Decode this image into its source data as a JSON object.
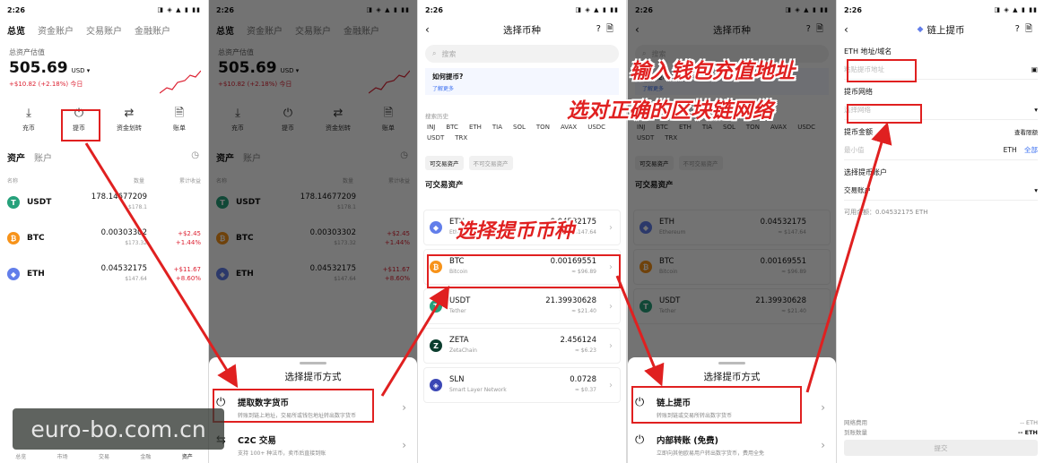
{
  "status": {
    "time": "2:26",
    "icons": "◨ ◈ ▲ ▮ ▮▮"
  },
  "screen1": {
    "tabs": [
      "总览",
      "资金账户",
      "交易账户",
      "金融账户"
    ],
    "balance_label": "总资产估值",
    "balance": "505.69",
    "balance_unit": "USD ▾",
    "pnl": "+$10.82 (+2.18%) 今日",
    "actions": [
      {
        "icon": "download-icon",
        "glyph": "⤓",
        "label": "充币"
      },
      {
        "icon": "withdraw-icon",
        "glyph": "⏻",
        "label": "提币"
      },
      {
        "icon": "transfer-icon",
        "glyph": "⇄",
        "label": "资金划转"
      },
      {
        "icon": "bill-icon",
        "glyph": "🗎",
        "label": "账单"
      }
    ],
    "subtabs": [
      "资产",
      "账户"
    ],
    "col_headers": [
      "名称",
      "数量",
      "累计收益"
    ],
    "assets": [
      {
        "symbol": "USDT",
        "amount": "178.14677209",
        "usd": "$178.1",
        "pnl": "",
        "pnl2": ""
      },
      {
        "symbol": "BTC",
        "amount": "0.00303302",
        "usd": "$173.32",
        "pnl": "+$2.45",
        "pnl2": "+1.44%"
      },
      {
        "symbol": "ETH",
        "amount": "0.04532175",
        "usd": "$147.64",
        "pnl": "+$11.67",
        "pnl2": "+8.60%"
      }
    ],
    "nav": [
      "总览",
      "市场",
      "交易",
      "金融",
      "资产"
    ]
  },
  "screen2": {
    "sheet_title": "选择提币方式",
    "option1_title": "提取数字货币",
    "option1_sub": "转账到链上地址，交易所或钱包地址转出数字货币",
    "option2_title": "C2C 交易",
    "option2_sub": "支持 100+ 种法币，卖币后直接到账"
  },
  "screen3": {
    "title": "选择币种",
    "search_placeholder": "搜索",
    "tip_title": "如何提币?",
    "tip_link": "了解更多",
    "popular_label": "搜索历史",
    "chips": [
      "INJ",
      "BTC",
      "ETH",
      "TIA",
      "SOL",
      "TON",
      "AVAX",
      "USDC",
      "USDT",
      "TRX"
    ],
    "pill_on": "可交易资产",
    "pill_off": "不可交易资产",
    "section": "可交易资产",
    "coins": [
      {
        "symbol": "ETH",
        "name": "Ethereum",
        "amount": "0.04532175",
        "usd": "≈ $147.64"
      },
      {
        "symbol": "BTC",
        "name": "Bitcoin",
        "amount": "0.00169551",
        "usd": "≈ $96.89"
      },
      {
        "symbol": "USDT",
        "name": "Tether",
        "amount": "21.39930628",
        "usd": "≈ $21.40"
      },
      {
        "symbol": "ZETA",
        "name": "ZetaChain",
        "amount": "2.456124",
        "usd": "≈ $6.23"
      },
      {
        "symbol": "SLN",
        "name": "Smart Layer Network",
        "amount": "0.0728",
        "usd": "≈ $0.37"
      }
    ]
  },
  "screen4": {
    "sheet_title": "选择提币方式",
    "option1_title": "链上提币",
    "option1_sub": "转账到链或交易所转出数字货币",
    "option2_title": "内部转账 (免费)",
    "option2_sub": "立即向其他欧易用户转出数字货币，费用全免"
  },
  "screen5": {
    "title": "链上提币",
    "address_label": "ETH 地址/域名",
    "address_placeholder": "粘贴提币地址",
    "network_label": "提币网络",
    "network_placeholder": "选择网络",
    "amount_label": "提币金额",
    "amount_link": "查看限额",
    "amount_placeholder": "最小值",
    "amount_unit": "ETH",
    "amount_all": "全部",
    "account_label": "选择提币账户",
    "account_value": "交易账户",
    "available": "可用余额：0.04532175 ETH",
    "fee_label": "网络费用",
    "fee_value": "-- ETH",
    "receive_label": "到账数量",
    "receive_value": "-- ETH",
    "submit": "提交"
  },
  "captions": {
    "enter_address": "输入钱包充值地址",
    "select_chain": "选对正确的区块链网络",
    "select_coin": "选择提币币种"
  },
  "watermark": "euro-bo.com.cn",
  "colors": {
    "annotation": "#e02020",
    "negative": "#dd2233",
    "link": "#3a6ff0"
  }
}
